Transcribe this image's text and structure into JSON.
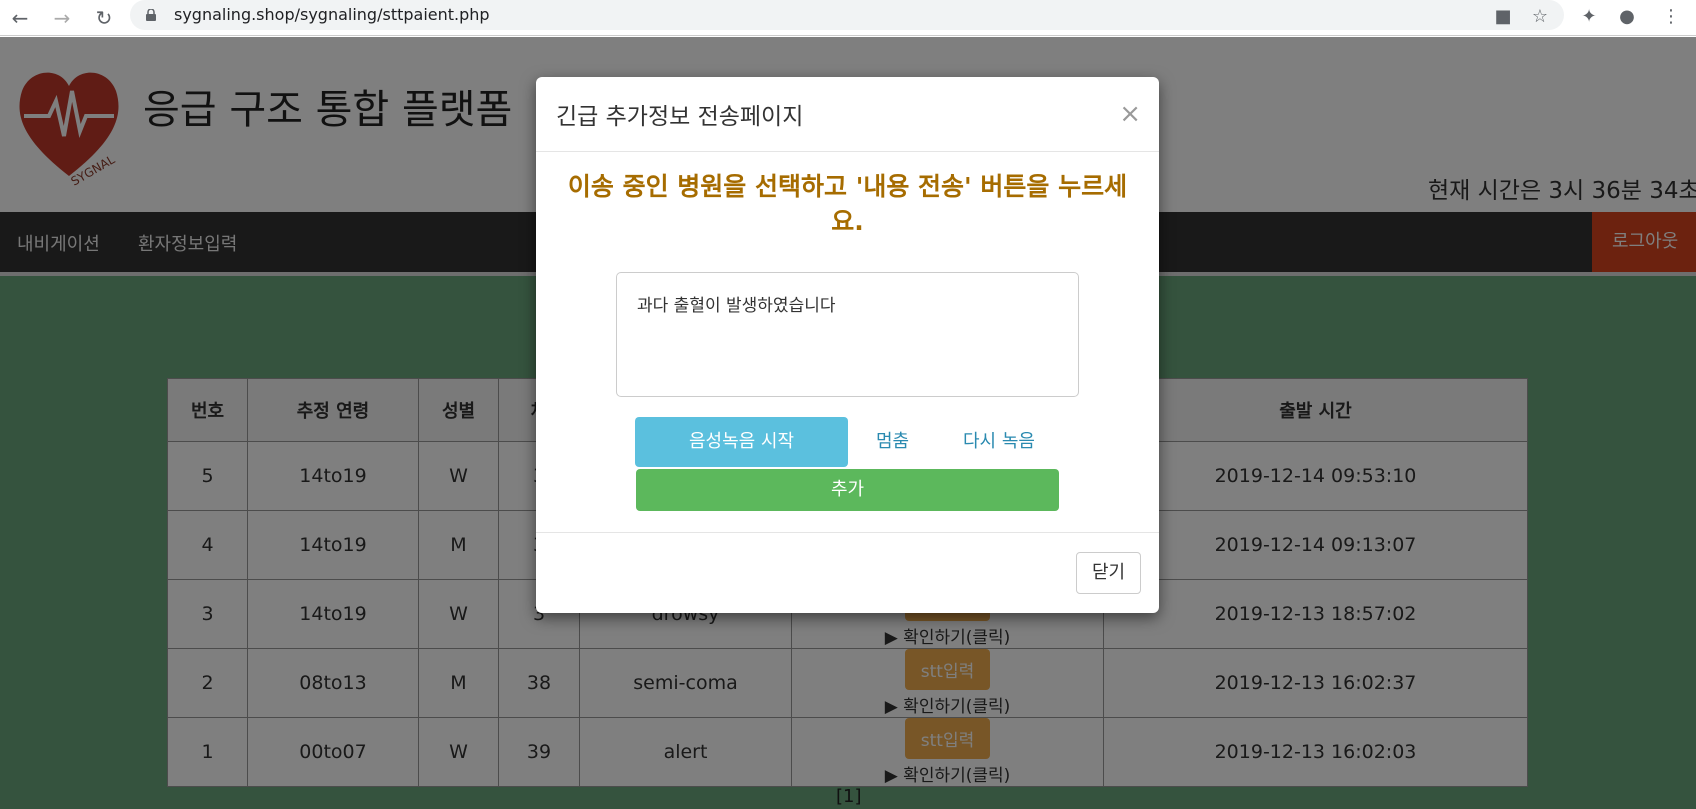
{
  "browser": {
    "url": "sygnaling.shop/sygnaling/sttpaient.php"
  },
  "header": {
    "site_title": "응급 구조 통합 플랫폼",
    "clock": "현재 시간은 3시 36분 34초."
  },
  "navbar": {
    "items": [
      {
        "label": "내비게이션"
      },
      {
        "label": "환자정보입력"
      }
    ],
    "logout_label": "로그아웃"
  },
  "table": {
    "headers": [
      "번호",
      "추정 연령",
      "성별",
      "체",
      "",
      "",
      "출발 시간"
    ],
    "stt_label": "stt입력",
    "check_label": "▶ 확인하기(클릭)",
    "rows": [
      {
        "no": "5",
        "age": "14to19",
        "sex": "W",
        "temp": "3",
        "state": "",
        "time": "2019-12-14 09:53:10"
      },
      {
        "no": "4",
        "age": "14to19",
        "sex": "M",
        "temp": "3",
        "state": "",
        "time": "2019-12-14 09:13:07"
      },
      {
        "no": "3",
        "age": "14to19",
        "sex": "W",
        "temp": "3",
        "state": "drowsy",
        "time": "2019-12-13 18:57:02"
      },
      {
        "no": "2",
        "age": "08to13",
        "sex": "M",
        "temp": "38",
        "state": "semi-coma",
        "time": "2019-12-13 16:02:37"
      },
      {
        "no": "1",
        "age": "00to07",
        "sex": "W",
        "temp": "39",
        "state": "alert",
        "time": "2019-12-13 16:02:03"
      }
    ],
    "pager": "[1]"
  },
  "modal": {
    "title": "긴급 추가정보 전송페이지",
    "close_x": "×",
    "prompt": "이송 중인 병원을 선택하고 '내용 전송' 버튼을 누르세요.",
    "textarea_value": "과다 출혈이 발생하였습니다",
    "record_label": "음성녹음 시작",
    "stop_label": "멈춤",
    "rerecord_label": "다시 녹음",
    "add_label": "추가",
    "close_label": "닫기"
  },
  "colors": {
    "navbar": "#333333",
    "logout": "#d9441e",
    "main_bg": "#6aa77d",
    "prompt": "#a66c00",
    "record_btn": "#5bc0de",
    "add_btn": "#5cb85c",
    "stt_btn": "#f0ad4e"
  }
}
